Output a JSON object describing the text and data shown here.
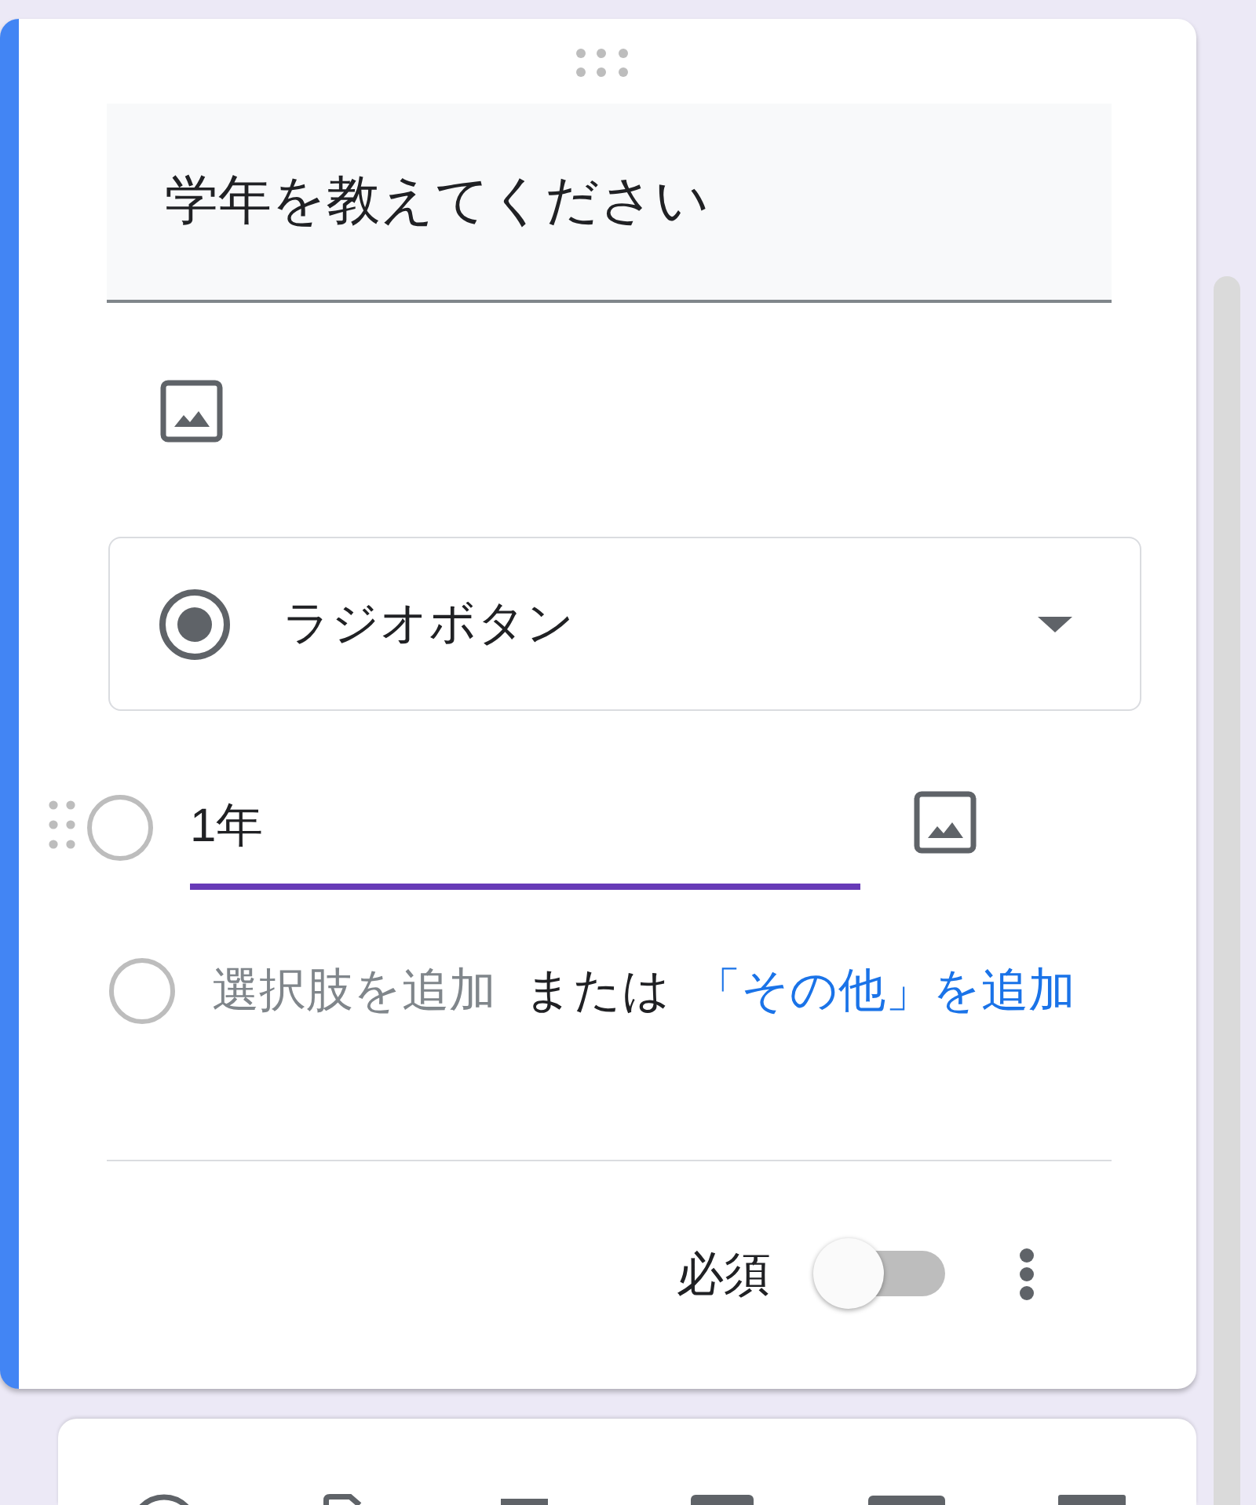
{
  "question_card": {
    "active": true,
    "title": "学年を教えてください",
    "question_type": "ラジオボタン",
    "options": [
      {
        "value": "1年",
        "focused": true
      }
    ],
    "add_option": {
      "add_label": "選択肢を追加",
      "separator": "または",
      "add_other_link": "「その他」を追加"
    },
    "required": {
      "label": "必須",
      "on": false
    }
  }
}
